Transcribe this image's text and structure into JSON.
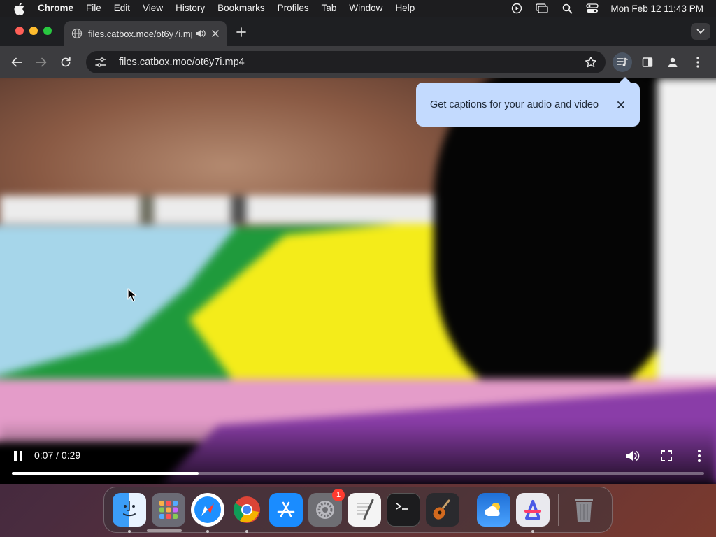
{
  "menubar": {
    "apple_icon": "apple-icon",
    "app_name": "Chrome",
    "items": [
      "File",
      "Edit",
      "View",
      "History",
      "Bookmarks",
      "Profiles",
      "Tab",
      "Window",
      "Help"
    ],
    "status_icons": [
      "media-play-icon",
      "screen-mirror-icon",
      "search-icon",
      "control-center-icon"
    ],
    "clock": "Mon Feb 12  11:43 PM"
  },
  "tab": {
    "title": "files.catbox.moe/ot6y7i.mp4",
    "audio_icon": "speaker-icon",
    "close_icon": "close-icon"
  },
  "toolbar": {
    "url": "files.catbox.moe/ot6y7i.mp4"
  },
  "caption_bubble": {
    "text": "Get captions for your audio and video"
  },
  "video": {
    "current_time": "0:07 / 0:29",
    "progress": 0.27
  },
  "dock": {
    "apps": [
      "Finder",
      "Launchpad",
      "Safari",
      "Chrome",
      "App Store",
      "System Settings",
      "TextEdit",
      "Terminal",
      "GarageBand",
      "Weather",
      "Spark",
      "Trash"
    ],
    "settings_badge": "1"
  },
  "colors": {
    "menubar_bg": "#1d1d1f",
    "tab_bg": "#3c3c3f",
    "bubble_bg": "#c3dafe",
    "badge": "#ff3b30"
  }
}
